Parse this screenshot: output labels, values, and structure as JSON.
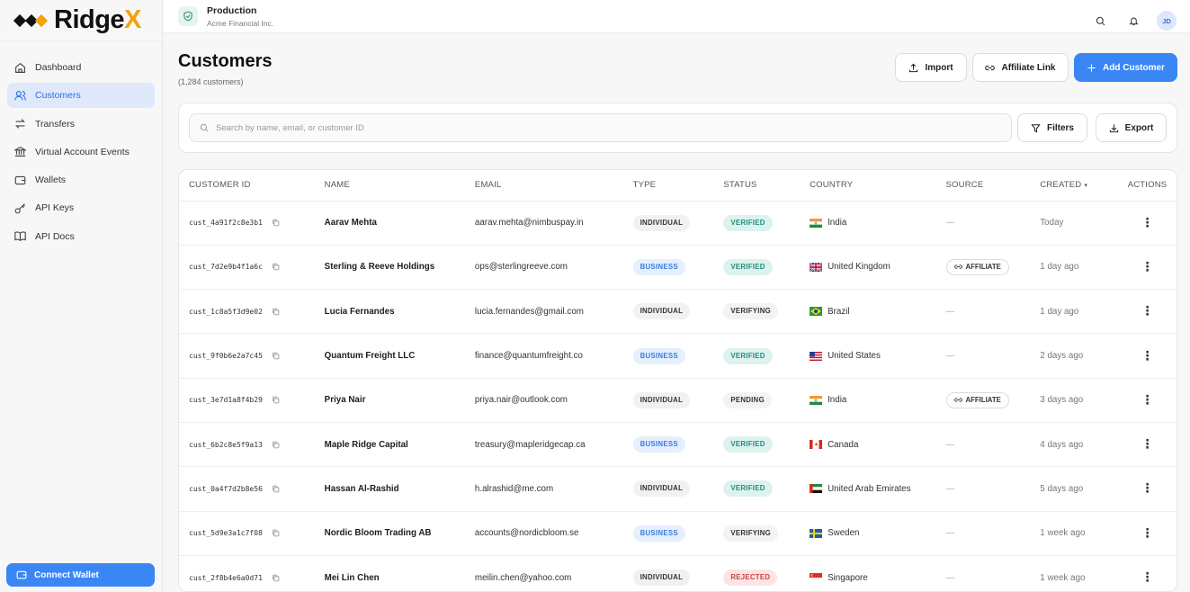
{
  "brand": {
    "name": "Ridge",
    "accent_letter": "X",
    "accent_color": "#f5a20a"
  },
  "env": {
    "title": "Production",
    "subtitle": "Acme Financial Inc."
  },
  "avatar": {
    "initials": "JD"
  },
  "sidebar": {
    "items": [
      {
        "label": "Dashboard",
        "icon": "home-icon"
      },
      {
        "label": "Customers",
        "icon": "users-icon",
        "active": true
      },
      {
        "label": "Transfers",
        "icon": "transfer-icon"
      },
      {
        "label": "Virtual Account Events",
        "icon": "bank-icon"
      },
      {
        "label": "Wallets",
        "icon": "wallet-icon"
      },
      {
        "label": "API Keys",
        "icon": "key-icon"
      },
      {
        "label": "API Docs",
        "icon": "book-icon"
      }
    ],
    "connect_label": "Connect Wallet"
  },
  "page": {
    "title": "Customers",
    "subtitle": "(1,284 customers)"
  },
  "actions": {
    "import": "Import",
    "affiliate": "Affiliate Link",
    "add": "Add Customer"
  },
  "search": {
    "placeholder": "Search by name, email, or customer ID",
    "filters": "Filters",
    "export": "Export"
  },
  "table": {
    "columns": [
      "CUSTOMER ID",
      "NAME",
      "EMAIL",
      "TYPE",
      "STATUS",
      "COUNTRY",
      "SOURCE",
      "CREATED",
      "ACTIONS"
    ],
    "rows": [
      {
        "id": "cust_4a91f2c8e3b1",
        "name": "Aarav Mehta",
        "email": "aarav.mehta@nimbuspay.in",
        "type": "INDIVIDUAL",
        "status": "VERIFIED",
        "country": "India",
        "flag": "in",
        "source": "—",
        "created": "Today"
      },
      {
        "id": "cust_7d2e9b4f1a6c",
        "name": "Sterling & Reeve Holdings",
        "email": "ops@sterlingreeve.com",
        "type": "BUSINESS",
        "status": "VERIFIED",
        "country": "United Kingdom",
        "flag": "gb",
        "source": "AFFILIATE",
        "created": "1 day ago"
      },
      {
        "id": "cust_1c8a5f3d9e02",
        "name": "Lucia Fernandes",
        "email": "lucia.fernandes@gmail.com",
        "type": "INDIVIDUAL",
        "status": "VERIFYING",
        "country": "Brazil",
        "flag": "br",
        "source": "—",
        "created": "1 day ago"
      },
      {
        "id": "cust_9f0b6e2a7c45",
        "name": "Quantum Freight LLC",
        "email": "finance@quantumfreight.co",
        "type": "BUSINESS",
        "status": "VERIFIED",
        "country": "United States",
        "flag": "us",
        "source": "—",
        "created": "2 days ago"
      },
      {
        "id": "cust_3e7d1a8f4b29",
        "name": "Priya Nair",
        "email": "priya.nair@outlook.com",
        "type": "INDIVIDUAL",
        "status": "PENDING",
        "country": "India",
        "flag": "in",
        "source": "AFFILIATE",
        "created": "3 days ago"
      },
      {
        "id": "cust_6b2c8e5f9a13",
        "name": "Maple Ridge Capital",
        "email": "treasury@mapleridgecap.ca",
        "type": "BUSINESS",
        "status": "VERIFIED",
        "country": "Canada",
        "flag": "ca",
        "source": "—",
        "created": "4 days ago"
      },
      {
        "id": "cust_0a4f7d2b8e56",
        "name": "Hassan Al-Rashid",
        "email": "h.alrashid@me.com",
        "type": "INDIVIDUAL",
        "status": "VERIFIED",
        "country": "United Arab Emirates",
        "flag": "ae",
        "source": "—",
        "created": "5 days ago"
      },
      {
        "id": "cust_5d9e3a1c7f08",
        "name": "Nordic Bloom Trading AB",
        "email": "accounts@nordicbloom.se",
        "type": "BUSINESS",
        "status": "VERIFYING",
        "country": "Sweden",
        "flag": "se",
        "source": "—",
        "created": "1 week ago"
      },
      {
        "id": "cust_2f8b4e6a0d71",
        "name": "Mei Lin Chen",
        "email": "meilin.chen@yahoo.com",
        "type": "INDIVIDUAL",
        "status": "REJECTED",
        "country": "Singapore",
        "flag": "sg",
        "source": "—",
        "created": "1 week ago"
      }
    ]
  },
  "colors": {
    "primary": "#3a86f4",
    "verified": "#1f8f7a",
    "business": "#3a7be0",
    "rejected": "#d04040"
  }
}
